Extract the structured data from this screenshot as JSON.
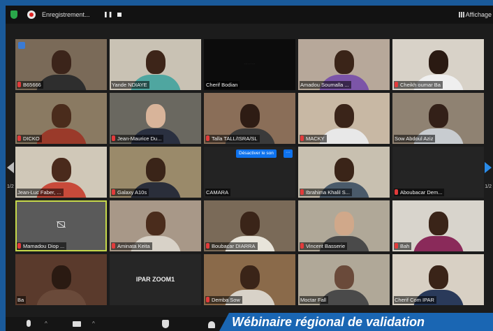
{
  "topbar": {
    "recording_label": "Enregistrement...",
    "pause_glyph": "❚❚",
    "view_label": "Affichage"
  },
  "tiles": [
    {
      "name": "B65666",
      "muted": true,
      "bg": "#7a6a58",
      "skin": "#3b241a",
      "shirt": "#2e2e2e",
      "raised_hand": true
    },
    {
      "name": "Yande NDIAYE",
      "muted": false,
      "bg": "#c9c2b4",
      "skin": "#3d2519",
      "shirt": "#4fa6a0"
    },
    {
      "name": "Cherif Bodian",
      "muted": false,
      "bg": "#0c0c0c",
      "skin": "#0c0c0c",
      "shirt": "#0c0c0c",
      "tiny_text": "· · · · · · · · ·"
    },
    {
      "name": "Amadou Soumalla ...",
      "muted": false,
      "bg": "#b7a89a",
      "skin": "#3a2418",
      "shirt": "#7c55a8"
    },
    {
      "name": "Cheikh oumar Ba",
      "muted": true,
      "bg": "#d8d2c8",
      "skin": "#2a1a12",
      "shirt": "#efefef"
    },
    {
      "name": "DICKO",
      "muted": true,
      "bg": "#8a7a62",
      "skin": "#4a2c1c",
      "shirt": "#9a3a2a"
    },
    {
      "name": "Jean-Maurice Du...",
      "muted": true,
      "bg": "#6a6860",
      "skin": "#d8b49a",
      "shirt": "#2a3040"
    },
    {
      "name": "Talla TALL/ISRA/SL",
      "muted": true,
      "bg": "#8a6e58",
      "skin": "#2e1c14",
      "shirt": "#3a3a3a"
    },
    {
      "name": "MACKY",
      "muted": true,
      "bg": "#c8b8a4",
      "skin": "#3a2419",
      "shirt": "#e8e8e8"
    },
    {
      "name": "Sow Abdoul Aziz",
      "muted": false,
      "bg": "#8f8272",
      "skin": "#332018",
      "shirt": "#c8ccd0"
    },
    {
      "name": "Jean-Luc Faber, ...",
      "muted": false,
      "bg": "#d0c8b8",
      "skin": "#4a2a1c",
      "shirt": "#c84a3a"
    },
    {
      "name": "Galaxy A10s",
      "muted": true,
      "bg": "#9a8a6a",
      "skin": "#3a2418",
      "shirt": "#2a2e3a"
    },
    {
      "name": "CAMARA",
      "muted": false,
      "bg": "#232323",
      "skin": "#232323",
      "shirt": "#232323",
      "context": {
        "mute_label": "Désactiver le son",
        "more_label": "···"
      }
    },
    {
      "name": "Ibrahima Khalil S...",
      "muted": true,
      "bg": "#c8c0b0",
      "skin": "#3a2418",
      "shirt": "#4a5a6a"
    },
    {
      "name": "Aboubacar Dem...",
      "muted": true,
      "bg": "#242424",
      "skin": "#242424",
      "shirt": "#242424"
    },
    {
      "name": "Mamadou Diop ...",
      "muted": true,
      "bg": "#5a5a5a",
      "skin": "#5a5a5a",
      "shirt": "#5a5a5a",
      "camera_off": true,
      "selected": true
    },
    {
      "name": "Aminata Keita",
      "muted": true,
      "bg": "#a89888",
      "skin": "#4a2c1c",
      "shirt": "#d8d2c8"
    },
    {
      "name": "Boubacar DIARRA",
      "muted": true,
      "bg": "#7a6a58",
      "skin": "#3a2418",
      "shirt": "#e8e4da"
    },
    {
      "name": "Vincent Basserie",
      "muted": true,
      "bg": "#b0a898",
      "skin": "#d0a88a",
      "shirt": "#4a4a4a"
    },
    {
      "name": "Bah",
      "muted": true,
      "bg": "#d8d4cc",
      "skin": "#3a2418",
      "shirt": "#8a2a5a"
    },
    {
      "name": "Ba",
      "muted": false,
      "bg": "#5a3a2c",
      "skin": "#2a1a12",
      "shirt": "#6a4a3a"
    },
    {
      "name": "",
      "muted": false,
      "bg": "#262626",
      "skin": "#262626",
      "shirt": "#262626",
      "center_text": "IPAR ZOOM1"
    },
    {
      "name": "Demba Sow",
      "muted": true,
      "bg": "#8a6a4a",
      "skin": "#3a2418",
      "shirt": "#d8d2c8"
    },
    {
      "name": "Moctar Fall",
      "muted": false,
      "bg": "#b0a898",
      "skin": "#6a4a3a",
      "shirt": "#4a4a4a"
    },
    {
      "name": "Cherif Com IPAR",
      "muted": false,
      "bg": "#d8d0c4",
      "skin": "#3a2418",
      "shirt": "#2a3a5a"
    }
  ],
  "nav": {
    "left_page": "1/2",
    "right_page": "1/2"
  },
  "banner": {
    "text": "Wébinaire régional de validation"
  }
}
